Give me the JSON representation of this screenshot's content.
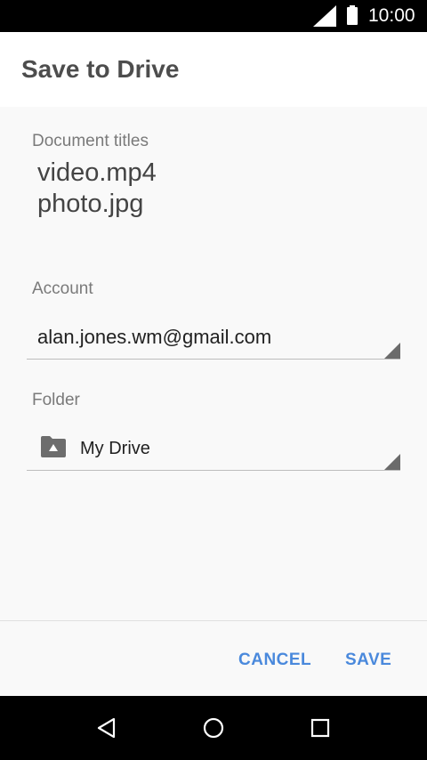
{
  "status_bar": {
    "time": "10:00",
    "icons": [
      "signal-icon",
      "battery-icon"
    ]
  },
  "header": {
    "title": "Save to Drive"
  },
  "documents": {
    "label": "Document titles",
    "titles": [
      "video.mp4",
      "photo.jpg"
    ]
  },
  "account": {
    "label": "Account",
    "value": "alan.jones.wm@gmail.com"
  },
  "folder": {
    "label": "Folder",
    "value": "My Drive",
    "icon": "drive-folder-icon"
  },
  "actions": {
    "cancel_label": "CANCEL",
    "save_label": "SAVE"
  },
  "colors": {
    "accent": "#4a89dc",
    "status_bar": "#000000",
    "nav_bar": "#000000"
  },
  "nav": {
    "icons": [
      "back-icon",
      "home-icon",
      "recents-icon"
    ]
  }
}
